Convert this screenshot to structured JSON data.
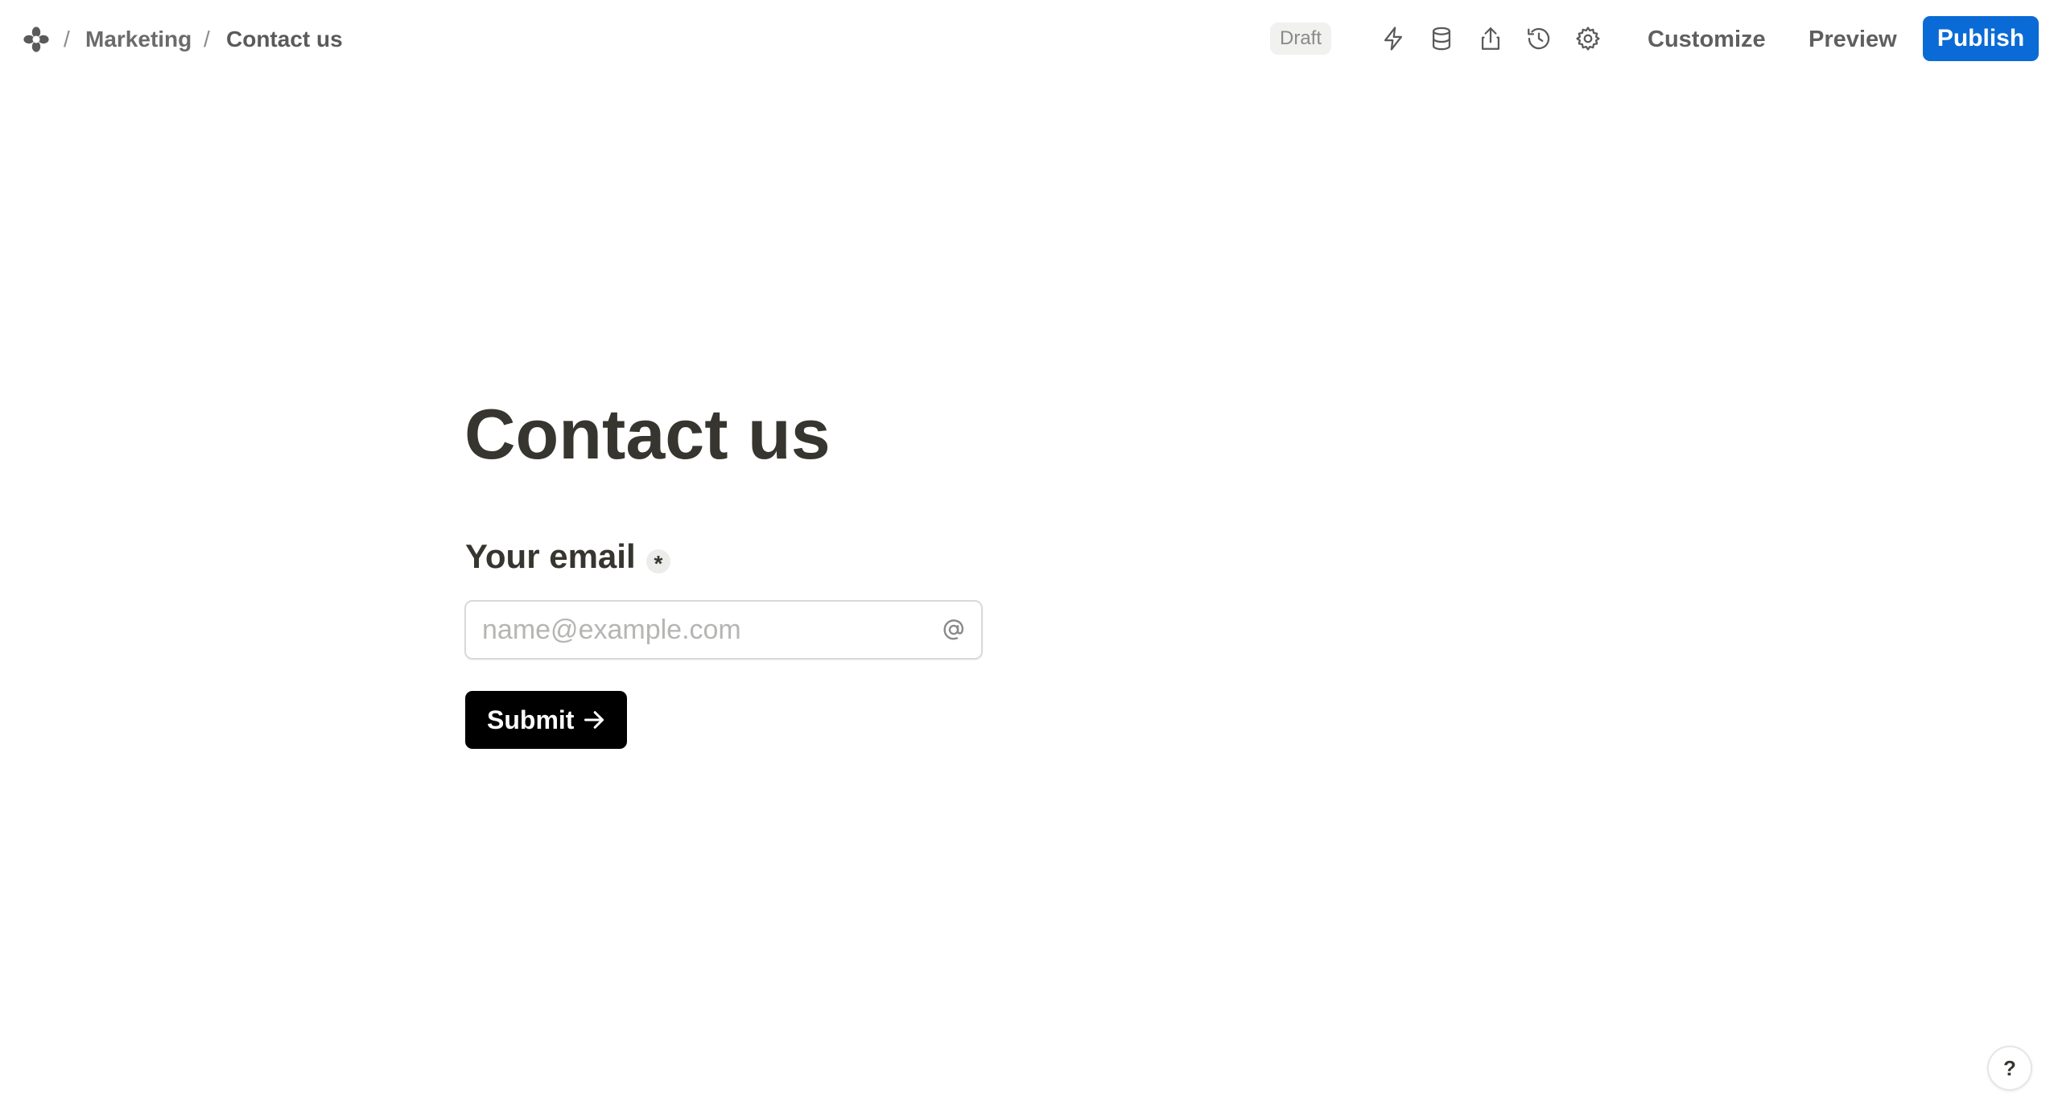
{
  "breadcrumb": {
    "items": [
      "Marketing",
      "Contact us"
    ],
    "separator": "/"
  },
  "toolbar": {
    "status_badge": "Draft",
    "icons": [
      "lightning-icon",
      "database-icon",
      "share-icon",
      "history-icon",
      "gear-icon"
    ],
    "customize_label": "Customize",
    "preview_label": "Preview",
    "publish_label": "Publish",
    "publish_color": "#0b6bd6"
  },
  "form": {
    "title": "Contact us",
    "field_label": "Your email",
    "required_mark": "*",
    "email_placeholder": "name@example.com",
    "email_value": "",
    "submit_label": "Submit",
    "submit_color": "#000000"
  },
  "help": {
    "label": "?"
  }
}
